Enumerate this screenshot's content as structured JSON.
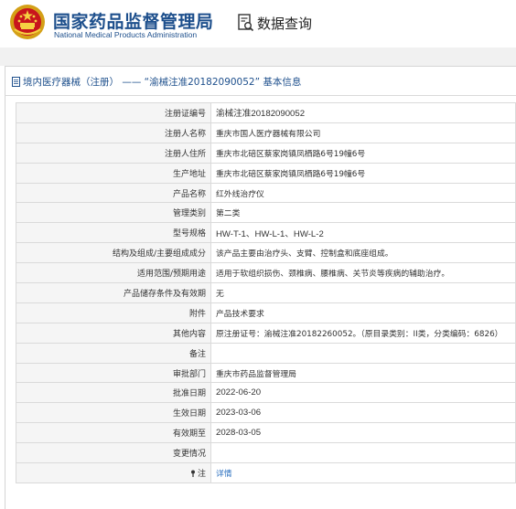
{
  "header": {
    "site_title_cn": "国家药品监督管理局",
    "site_title_en": "National Medical Products Administration",
    "emblem_icon": "national-emblem-icon",
    "nav_icon": "data-search-icon",
    "nav_title": "数据查询"
  },
  "breadcrumb": {
    "icon": "document-icon",
    "text": "境内医疗器械（注册） —— “渝械注准20182090052” 基本信息"
  },
  "colors": {
    "brand": "#1d4f8c",
    "link": "#2a6fbf",
    "label_bg": "#f5f5f5",
    "border": "#dadada"
  },
  "record": [
    {
      "label": "注册证编号",
      "value": "渝械注准20182090052"
    },
    {
      "label": "注册人名称",
      "value": "重庆市国人医疗器械有限公司"
    },
    {
      "label": "注册人住所",
      "value": "重庆市北碚区蔡家岗镇凤栖路6号19幢6号"
    },
    {
      "label": "生产地址",
      "value": "重庆市北碚区蔡家岗镇凤栖路6号19幢6号"
    },
    {
      "label": "产品名称",
      "value": "红外线治疗仪"
    },
    {
      "label": "管理类别",
      "value": "第二类"
    },
    {
      "label": "型号规格",
      "value": "HW-T-1、HW-L-1、HW-L-2"
    },
    {
      "label": "结构及组成/主要组成成分",
      "value": "该产品主要由治疗头、支臂、控制盒和底座组成。"
    },
    {
      "label": "适用范围/预期用途",
      "value": "适用于软组织损伤、颈椎病、腰椎病、关节炎等疾病的辅助治疗。"
    },
    {
      "label": "产品储存条件及有效期",
      "value": "无"
    },
    {
      "label": "附件",
      "value": "产品技术要求"
    },
    {
      "label": "其他内容",
      "value": "原注册证号：渝械注准20182260052。（原目录类别：II类，分类编码：6826）"
    },
    {
      "label": "备注",
      "value": ""
    },
    {
      "label": "审批部门",
      "value": "重庆市药品监督管理局"
    },
    {
      "label": "批准日期",
      "value": "2022-06-20"
    },
    {
      "label": "生效日期",
      "value": "2023-03-06"
    },
    {
      "label": "有效期至",
      "value": "2028-03-05"
    },
    {
      "label": "变更情况",
      "value": ""
    },
    {
      "label": "注",
      "value": "详情"
    }
  ]
}
